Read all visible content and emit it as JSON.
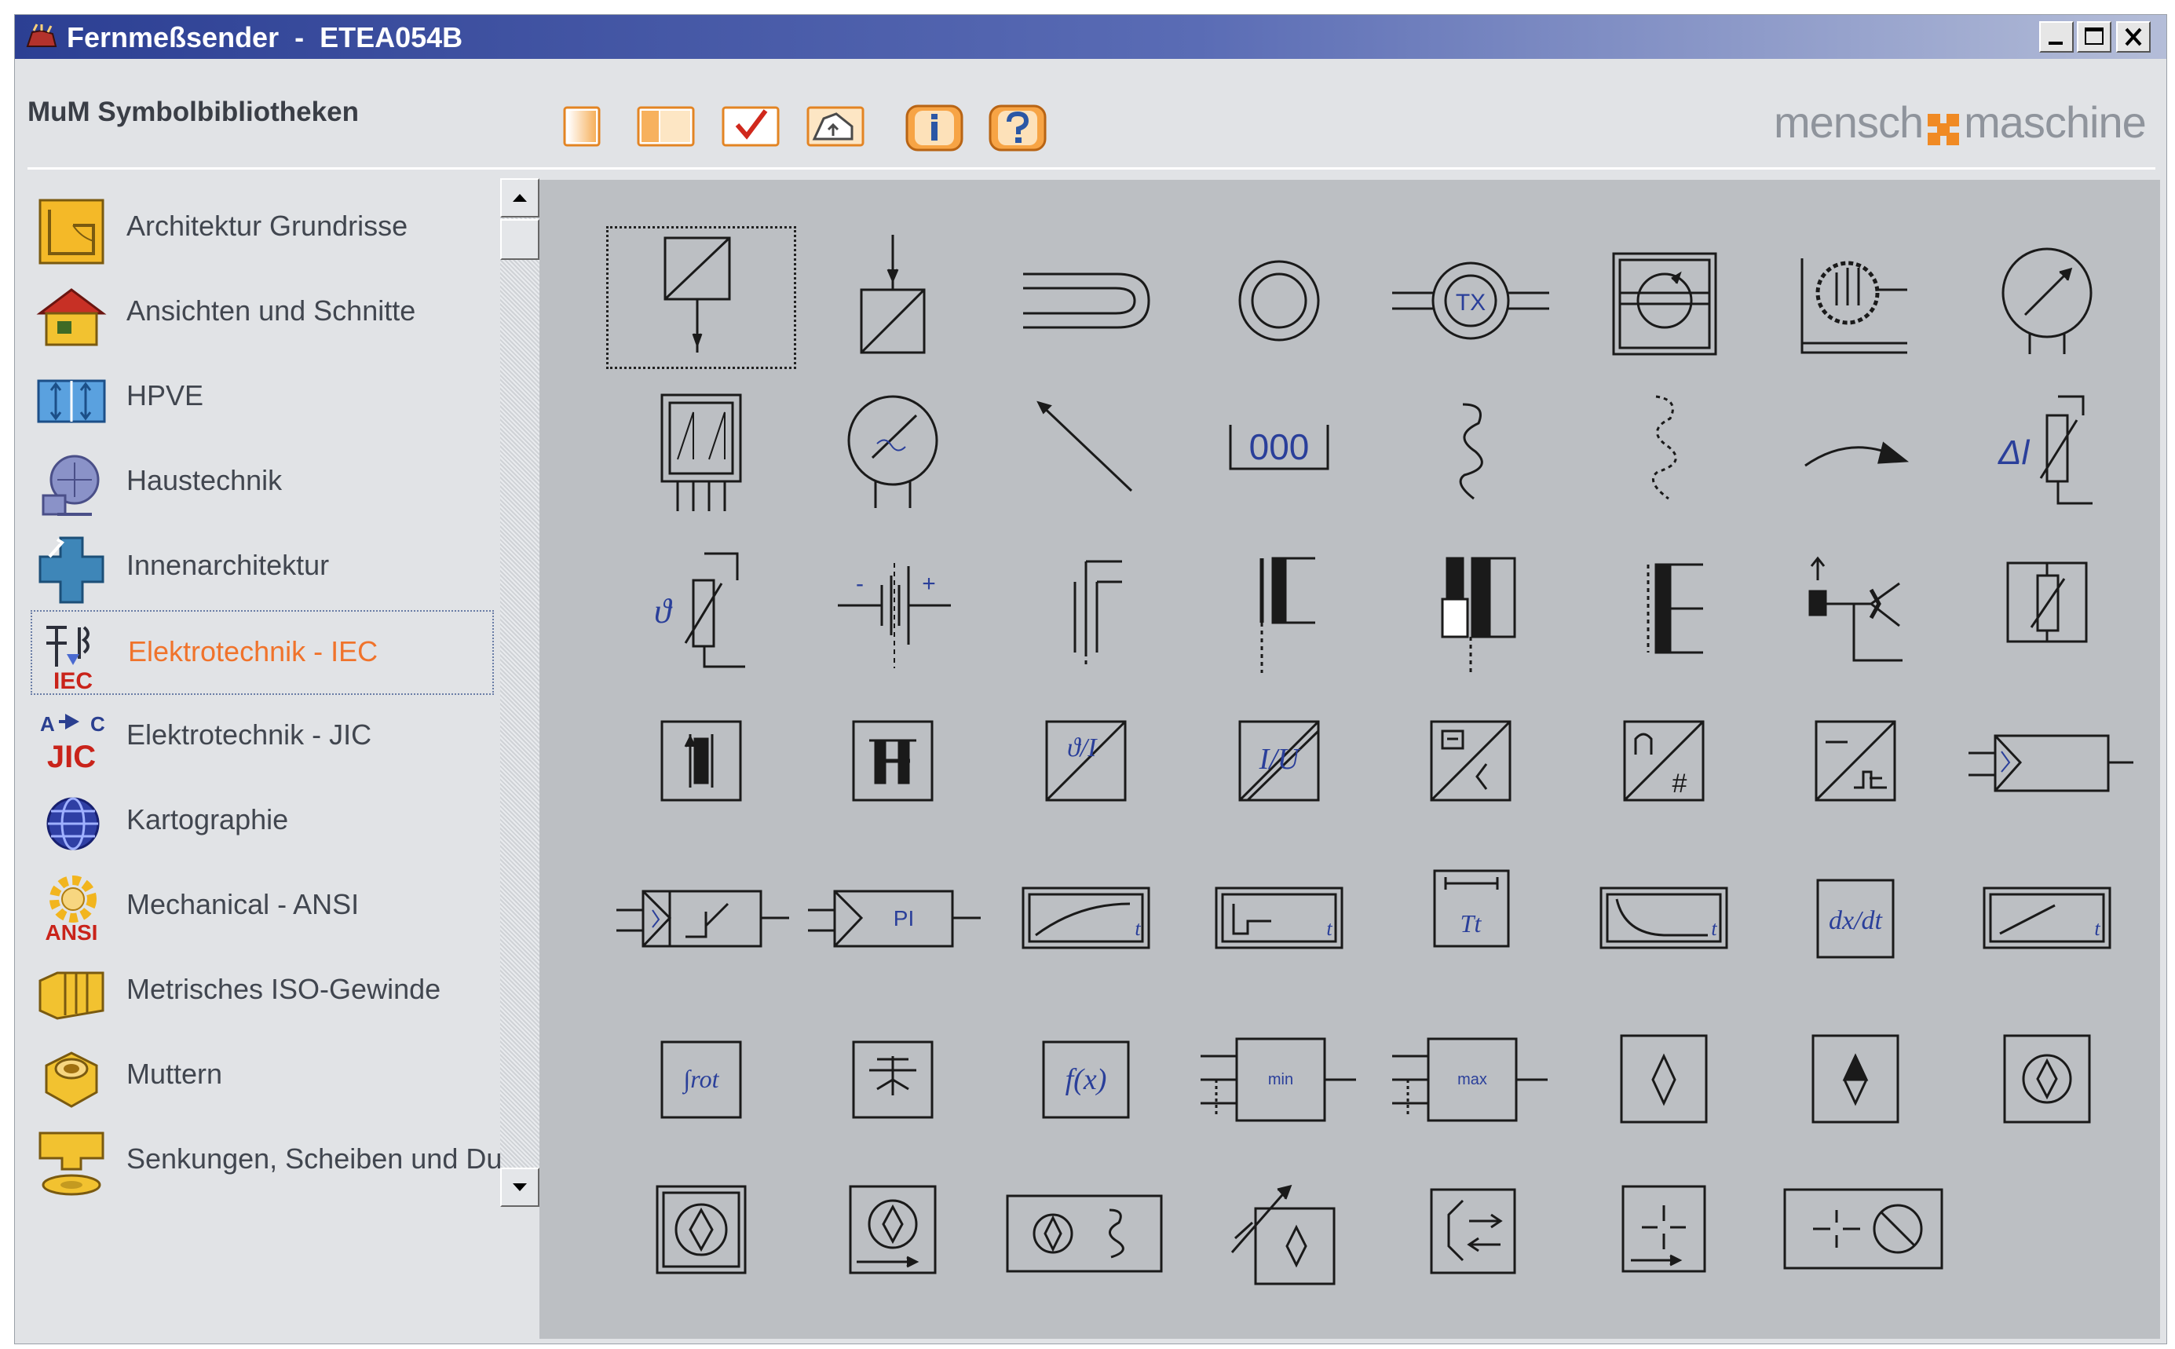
{
  "window": {
    "title": "Fernmeßsender  -  ETEA054B",
    "buttons": [
      {
        "name": "minimize-button",
        "icon": "minimize-icon"
      },
      {
        "name": "maximize-button",
        "icon": "maximize-icon"
      },
      {
        "name": "close-button",
        "icon": "close-icon"
      }
    ]
  },
  "header": {
    "title": "MuM Symbolbibliotheken",
    "brand_left": "mensch",
    "brand_right": "maschine",
    "brand_accent": "#f08a24"
  },
  "toolbar": {
    "buttons": [
      {
        "icon": "single-page-icon"
      },
      {
        "icon": "double-page-icon"
      },
      {
        "icon": "checkmark-icon"
      },
      {
        "icon": "folder-up-icon"
      },
      {
        "icon": "info-icon"
      },
      {
        "icon": "help-icon"
      }
    ],
    "accent": "#f29a3a"
  },
  "sidebar": {
    "items": [
      {
        "label": "Architektur Grundrisse",
        "icon": "floorplan-icon"
      },
      {
        "label": "Ansichten und Schnitte",
        "icon": "house-icon"
      },
      {
        "label": "HPVE",
        "icon": "hpve-icon"
      },
      {
        "label": "Haustechnik",
        "icon": "building-services-icon"
      },
      {
        "label": "Innenarchitektur",
        "icon": "interior-design-icon"
      },
      {
        "label": "Elektrotechnik - IEC",
        "icon": "iec-icon",
        "icon_text": "IEC",
        "active": true
      },
      {
        "label": "Elektrotechnik - JIC",
        "icon": "jic-icon",
        "icon_text": "JIC"
      },
      {
        "label": "Kartographie",
        "icon": "globe-icon"
      },
      {
        "label": "Mechanical - ANSI",
        "icon": "gear-icon",
        "icon_text": "ANSI"
      },
      {
        "label": "Metrisches ISO-Gewinde",
        "icon": "thread-icon"
      },
      {
        "label": "Muttern",
        "icon": "nut-icon"
      },
      {
        "label": "Senkungen, Scheiben und Du",
        "icon": "washer-icon"
      }
    ],
    "active_color": "#f0732b"
  },
  "symbols": {
    "rows": [
      [
        "converter-symbol",
        "converter-arrow-symbol",
        "loop-antenna-symbol",
        "ring-symbol",
        "transmitter-tx-symbol",
        "rotating-sensor-symbol",
        "radiation-sensor-symbol",
        "measuring-instrument-symbol"
      ],
      [
        "hall-sensor-symbol",
        "meter-symbol",
        "arrow-line-symbol",
        "counter-display-symbol",
        "resistor-wave-symbol",
        "dashed-wave-symbol",
        "curve-arrow-symbol",
        "delta-resistor-symbol"
      ],
      [
        "temperature-resistor-symbol",
        "battery-symbol",
        "contact-symbol",
        "capacitor-contact-symbol",
        "electrode-symbol",
        "switch-contact-symbol",
        "transistor-symbol",
        "fuse-box-symbol"
      ],
      [
        "vertical-contact-symbol",
        "h-contact-symbol",
        "temp-current-converter-symbol",
        "current-voltage-converter-symbol",
        "signal-converter-symbol",
        "analog-digital-converter-symbol",
        "pulse-converter-symbol",
        "amplifier-symbol"
      ],
      [
        "step-response-symbol",
        "pi-controller-symbol",
        "ramp-response-symbol",
        "step-function-symbol",
        "timer-symbol",
        "decay-function-symbol",
        "differentiator-symbol",
        "linear-ramp-symbol"
      ],
      [
        "integrator-symbol",
        "comparator-symbol",
        "function-fx-symbol",
        "minimum-selector-symbol",
        "maximum-selector-symbol",
        "diamond-box-symbol",
        "filled-diamond-box-symbol",
        "circle-diamond-symbol"
      ],
      [
        "double-frame-circle-symbol",
        "circle-arrow-symbol",
        "circle-wave-symbol",
        "adjustable-diamond-symbol",
        "bracket-arrow-symbol",
        "crosshair-symbol",
        "crosshair-circle-symbol"
      ]
    ],
    "text": {
      "tx": "TX",
      "counter": "000",
      "delta": "Δl",
      "theta": "ϑ",
      "minus": "-",
      "plus": "+",
      "vartheta_i": "ϑ/I",
      "i_u": "I/U",
      "n_hash": "#",
      "pi": "PI",
      "t": "t",
      "tt": "Tt",
      "dxdt": "dx/dt",
      "integral": "∫rot",
      "fx": "f(x)",
      "min": "min",
      "max": "max"
    }
  }
}
